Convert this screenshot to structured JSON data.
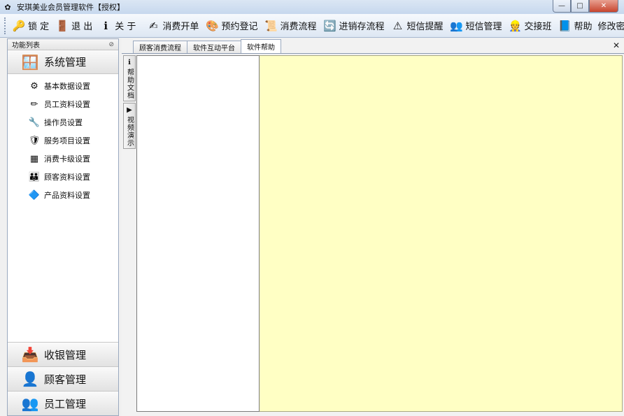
{
  "window": {
    "title": "安琪美业会员管理软件【授权】",
    "controls": {
      "minimize": "—",
      "maximize": "□",
      "close": "✕"
    }
  },
  "toolbar": {
    "items": [
      {
        "label": "锁 定",
        "icon": "key-icon",
        "glyph": "🔑"
      },
      {
        "label": "退 出",
        "icon": "exit-icon",
        "glyph": "🚪"
      },
      {
        "label": "关 于",
        "icon": "info-icon",
        "glyph": "ℹ"
      },
      {
        "label": "消费开单",
        "icon": "pen-icon",
        "glyph": "✍"
      },
      {
        "label": "预约登记",
        "icon": "appointment-icon",
        "glyph": "🎨"
      },
      {
        "label": "消费流程",
        "icon": "flow-icon",
        "glyph": "📜"
      },
      {
        "label": "进销存流程",
        "icon": "inventory-icon",
        "glyph": "🔄"
      },
      {
        "label": "短信提醒",
        "icon": "warning-icon",
        "glyph": "⚠"
      },
      {
        "label": "短信管理",
        "icon": "users-icon",
        "glyph": "👥"
      },
      {
        "label": "交接班",
        "icon": "handover-icon",
        "glyph": "👷"
      },
      {
        "label": "帮助",
        "icon": "help-icon",
        "glyph": "📘"
      },
      {
        "label": "修改密码",
        "icon": "",
        "glyph": ""
      }
    ]
  },
  "sidebar": {
    "header": "功能列表",
    "pin_glyph": "⊘",
    "active_group": {
      "label": "系统管理",
      "icon": "windows-logo-icon",
      "glyph": "🪟"
    },
    "items": [
      {
        "label": "基本数据设置",
        "icon": "data-settings-icon",
        "glyph": "⚙"
      },
      {
        "label": "员工资料设置",
        "icon": "staff-info-icon",
        "glyph": "✏"
      },
      {
        "label": "操作员设置",
        "icon": "operator-icon",
        "glyph": "🔧"
      },
      {
        "label": "服务项目设置",
        "icon": "service-icon",
        "glyph": "🛡"
      },
      {
        "label": "消费卡级设置",
        "icon": "card-level-icon",
        "glyph": "▦"
      },
      {
        "label": "顾客资料设置",
        "icon": "customer-info-icon",
        "glyph": "👪"
      },
      {
        "label": "产品资料设置",
        "icon": "product-icon",
        "glyph": "🔷"
      }
    ],
    "bottom_groups": [
      {
        "label": "收银管理",
        "icon": "cashier-icon",
        "glyph": "📥"
      },
      {
        "label": "顾客管理",
        "icon": "customer-icon",
        "glyph": "👤"
      },
      {
        "label": "员工管理",
        "icon": "staff-icon",
        "glyph": "👥"
      }
    ]
  },
  "tabs": [
    {
      "label": "顾客消费流程"
    },
    {
      "label": "软件互动平台"
    },
    {
      "label": "软件帮助"
    }
  ],
  "tab_close_glyph": "✕",
  "side_tabs": [
    {
      "label": "帮助文档",
      "icon": "help-doc-icon",
      "glyph": "ℹ"
    },
    {
      "label": "视频演示",
      "icon": "video-icon",
      "glyph": "▶"
    }
  ],
  "colors": {
    "content_bg": "#ffffc4",
    "accent": "#c8452e"
  }
}
